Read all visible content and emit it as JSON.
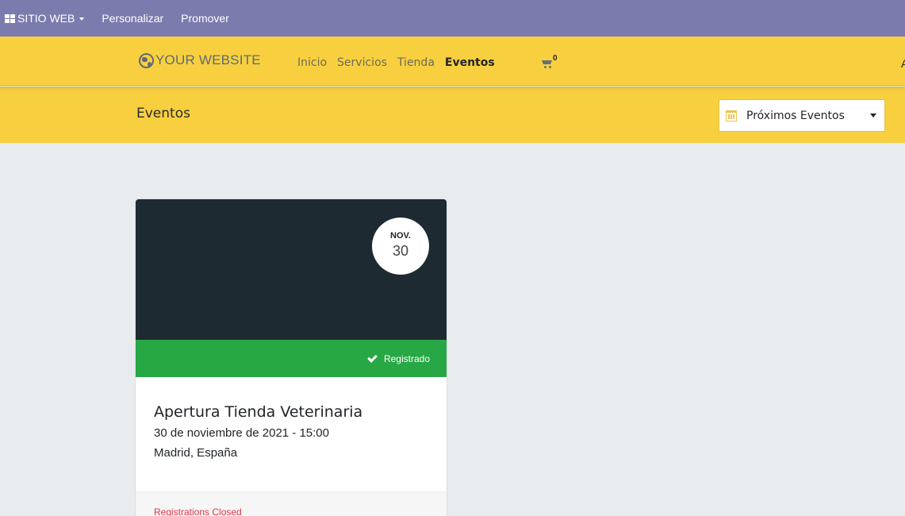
{
  "adminbar": {
    "apps_label": "SITIO WEB",
    "links": [
      "Personalizar",
      "Promover"
    ]
  },
  "header": {
    "logo_text": "YOUR WEBSITE",
    "nav": [
      "Inicio",
      "Servicios",
      "Tienda",
      "Eventos"
    ],
    "active_nav": "Eventos",
    "cart_count": "0",
    "edge_text": "A"
  },
  "titlebar": {
    "title": "Eventos",
    "filter_label": "Próximos Eventos"
  },
  "event": {
    "month": "NOV.",
    "day": "30",
    "status": "Registrado",
    "title": "Apertura Tienda Veterinaria",
    "datetime": "30 de noviembre de 2021 - 15:00",
    "location": "Madrid, España",
    "registration_note": "Registrations Closed"
  },
  "colors": {
    "adminbar": "#7c7bad",
    "header": "#f8d03f",
    "cover": "#1d2a32",
    "registered": "#28a745",
    "closed": "#dc3545",
    "background": "#e9ecef"
  },
  "icons": [
    "apps-grid-icon",
    "globe-icon",
    "cart-icon",
    "calendar-icon",
    "check-icon"
  ]
}
